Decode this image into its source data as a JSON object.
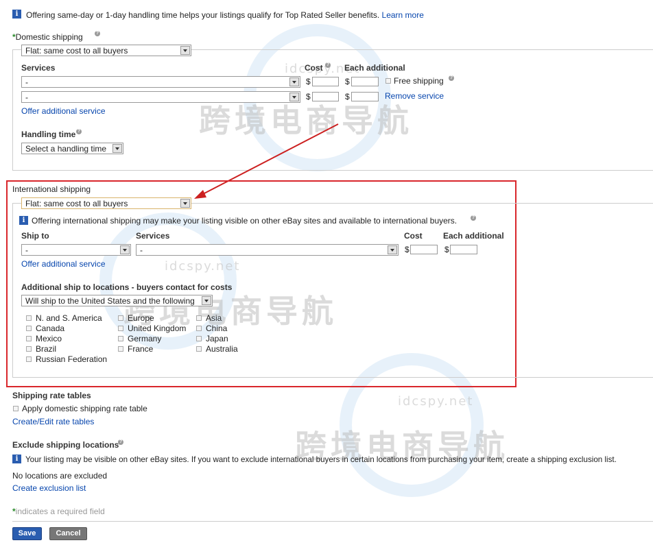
{
  "top_notice": {
    "text": "Offering same-day or 1-day handling time helps your listings qualify for Top Rated Seller benefits.",
    "link": "Learn more"
  },
  "domestic": {
    "required_mark": "*",
    "title": "Domestic shipping",
    "cost_type": "Flat: same cost to all buyers",
    "services_label": "Services",
    "cost_label": "Cost",
    "each_additional_label": "Each additional",
    "services": [
      {
        "value": "-",
        "currency": "$",
        "cost": "",
        "each_currency": "$",
        "each": "",
        "extra": "Free shipping"
      },
      {
        "value": "-",
        "currency": "$",
        "cost": "",
        "each_currency": "$",
        "each": "",
        "extra": "Remove service"
      }
    ],
    "offer_additional": "Offer additional service",
    "handling_time_label": "Handling time",
    "handling_time_value": "Select a handling time"
  },
  "international": {
    "title": "International shipping",
    "cost_type": "Flat: same cost to all buyers",
    "notice": "Offering international shipping may make your listing visible on other eBay sites and available to international buyers.",
    "ship_to_label": "Ship to",
    "services_label": "Services",
    "cost_label": "Cost",
    "each_additional_label": "Each additional",
    "ship_to_value": "-",
    "service_value": "-",
    "currency": "$",
    "each_currency": "$",
    "offer_additional": "Offer additional service",
    "additional_locations_label": "Additional ship to locations - buyers contact for costs",
    "additional_locations_value": "Will ship to the United States and the following",
    "locations": {
      "col1": [
        "N. and S. America",
        "Canada",
        "Mexico",
        "Brazil",
        "Russian Federation"
      ],
      "col2": [
        "Europe",
        "United Kingdom",
        "Germany",
        "France"
      ],
      "col3": [
        "Asia",
        "China",
        "Japan",
        "Australia"
      ]
    }
  },
  "rate_tables": {
    "title": "Shipping rate tables",
    "checkbox_label": "Apply domestic shipping rate table",
    "link": "Create/Edit rate tables"
  },
  "exclude": {
    "title": "Exclude shipping locations",
    "notice": "Your listing may be visible on other eBay sites. If you want to exclude international buyers in certain locations from purchasing your item, create a shipping exclusion list.",
    "status": "No locations are excluded",
    "link": "Create exclusion list"
  },
  "required_note": {
    "mark": "*",
    "text": "indicates a required field"
  },
  "buttons": {
    "save": "Save",
    "cancel": "Cancel"
  },
  "watermark": {
    "text": "跨境电商导航",
    "sub": "idcspy.net"
  },
  "colors": {
    "highlight_box": "#d9262b",
    "arrow": "#cc2020",
    "link": "#0645ad",
    "info": "#2a5db0",
    "save": "#2a5db0",
    "cancel": "#777777",
    "required": "#2a8a2a"
  }
}
